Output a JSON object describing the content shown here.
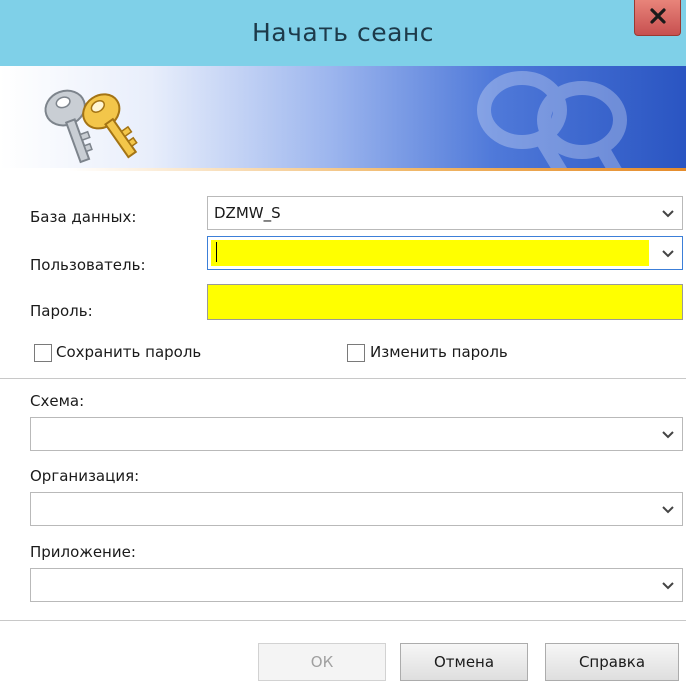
{
  "window": {
    "title": "Начать сеанс",
    "close_label": "x"
  },
  "form": {
    "database_label": "База данных:",
    "database_value": "DZMW_S",
    "user_label": "Пользователь:",
    "user_value": "",
    "password_label": "Пароль:",
    "password_value": "",
    "save_password_label": "Сохранить пароль",
    "save_password_checked": false,
    "change_password_label": "Изменить пароль",
    "change_password_checked": false,
    "schema_label": "Схема:",
    "schema_value": "",
    "organization_label": "Организация:",
    "organization_value": "",
    "application_label": "Приложение:",
    "application_value": ""
  },
  "buttons": {
    "ok_label": "ОК",
    "ok_enabled": false,
    "cancel_label": "Отмена",
    "help_label": "Справка"
  },
  "icons": {
    "banner_icon": "keys-icon",
    "dropdown_icon": "chevron-down-icon",
    "close_icon": "close-icon"
  },
  "colors": {
    "title_bar": "#7fd0e8",
    "highlight_fields": "#ffff00",
    "banner_end": "#2a55c2",
    "banner_accent_line": "#e58c2c"
  }
}
